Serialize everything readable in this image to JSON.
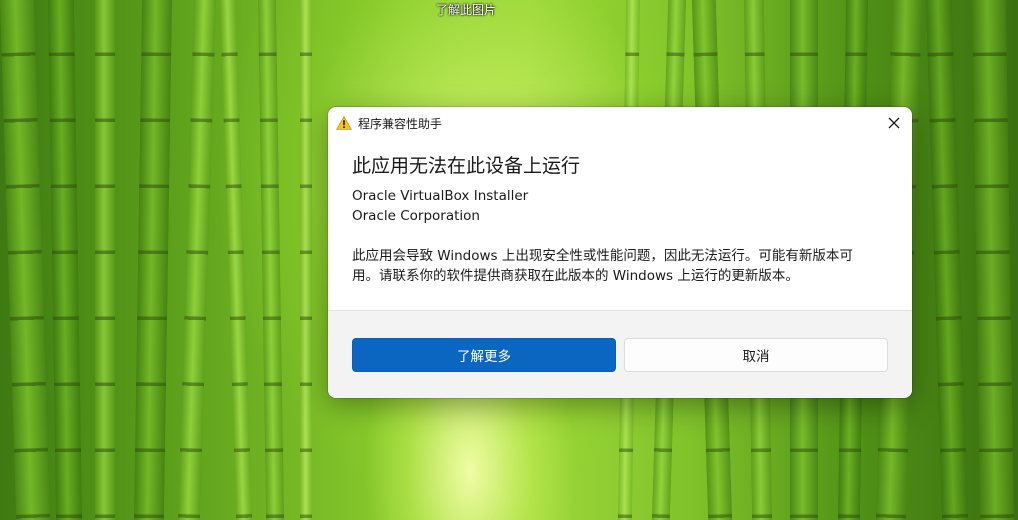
{
  "desktop": {
    "caption": "了解此图片"
  },
  "dialog": {
    "title": "程序兼容性助手",
    "heading": "此应用无法在此设备上运行",
    "app_name": "Oracle VirtualBox Installer",
    "publisher": "Oracle Corporation",
    "message": "此应用会导致 Windows 上出现安全性或性能问题，因此无法运行。可能有新版本可用。请联系你的软件提供商获取在此版本的 Windows 上运行的更新版本。",
    "primary_button": "了解更多",
    "secondary_button": "取消"
  },
  "icons": {
    "title_icon": "warning-icon",
    "close_icon": "close-icon"
  },
  "colors": {
    "primary_button": "#0b66c2",
    "footer": "#f3f3f3",
    "warning": "#f7c21b"
  }
}
